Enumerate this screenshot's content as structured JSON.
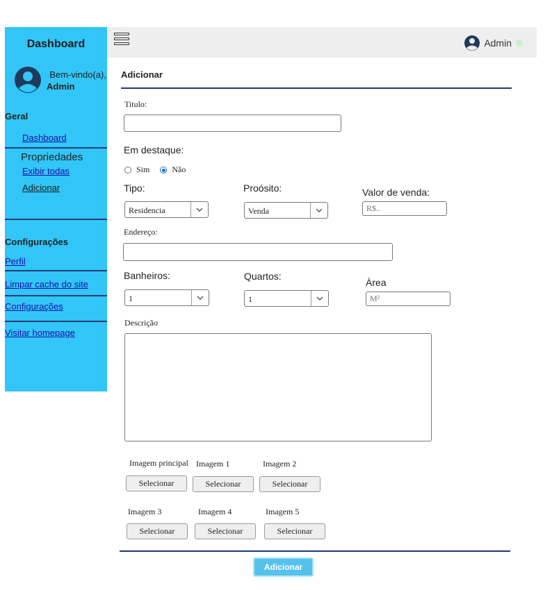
{
  "sidebar": {
    "title": "Dashboard",
    "welcome": "Bem-vindo(a),",
    "user": "Admin",
    "section_geral": "Geral",
    "link_dashboard": "Dashboard",
    "group_propriedades": "Propriedades",
    "link_exibir": "Exibir todas",
    "link_adicionar": "Adicionar",
    "section_config": "Configurações",
    "link_perfil": "Perfil",
    "link_cache": "Limpar cache do site",
    "link_config": "Configurações",
    "link_homepage": "Visitar homepage"
  },
  "topbar": {
    "user": "Admin",
    "online_color": "#c9f2c9"
  },
  "form": {
    "heading": "Adicionar",
    "titulo_label": "Titulo:",
    "titulo_value": "",
    "destaque_label": "Em destaque:",
    "radio_sim": "Sim",
    "radio_nao": "Não",
    "destaque_selected": "Não",
    "tipo_label": "Tipo:",
    "tipo_value": "Residencia",
    "proposito_label": "Proósito:",
    "proposito_value": "Venda",
    "valor_label": "Valor de venda:",
    "valor_placeholder": "R$..",
    "endereco_label": "Endereço:",
    "endereco_value": "",
    "banheiros_label": "Banheiros:",
    "banheiros_value": "1",
    "quartos_label": "Quartos:",
    "quartos_value": "1",
    "area_label": "Àrea",
    "area_placeholder": "M²",
    "descricao_label": "Descrição",
    "descricao_value": "",
    "images": [
      {
        "label": "Imagem principal",
        "button": "Selecionar"
      },
      {
        "label": "Imagem 1",
        "button": "Selecionar"
      },
      {
        "label": "Imagem 2",
        "button": "Selecionar"
      },
      {
        "label": "Imagem 3",
        "button": "Selecionar"
      },
      {
        "label": "Imagem 4",
        "button": "Selecionar"
      },
      {
        "label": "Imagem 5",
        "button": "Selecionar"
      }
    ],
    "submit": "Adicionar"
  },
  "colors": {
    "sidebar_bg": "#31c6f7",
    "divider": "#1d3a73",
    "submit_bg": "#55c2ec"
  }
}
